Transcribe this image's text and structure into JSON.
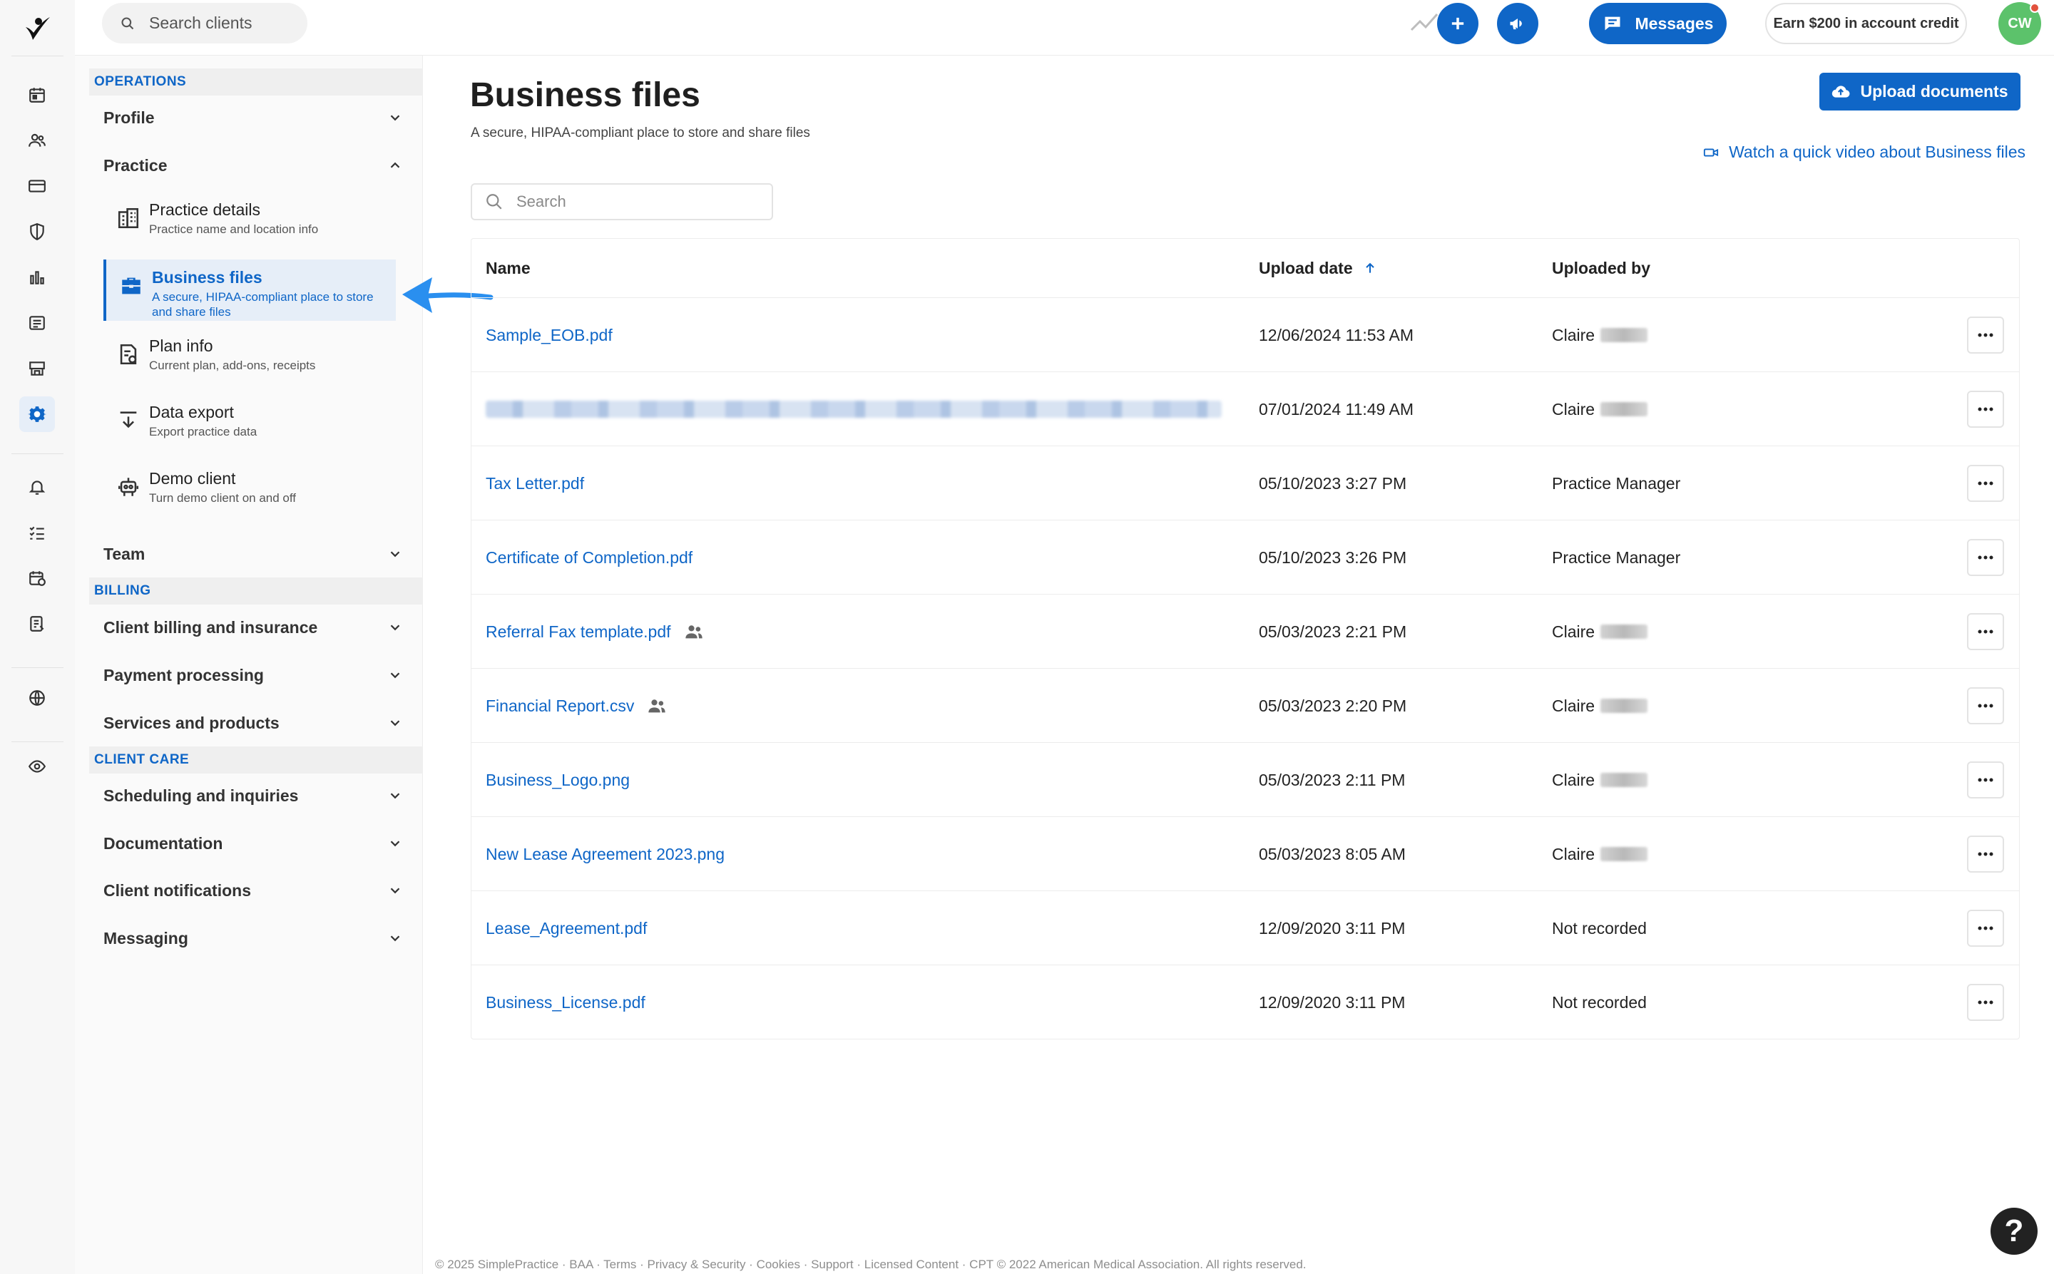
{
  "topbar": {
    "search_placeholder": "Search clients",
    "messages_label": "Messages",
    "earn_label": "Earn $200 in account credit",
    "avatar_initials": "CW"
  },
  "sidebar": {
    "sections": {
      "operations": "OPERATIONS",
      "billing": "BILLING",
      "client_care": "CLIENT CARE"
    },
    "accordions": {
      "profile": "Profile",
      "practice": "Practice",
      "team": "Team",
      "client_billing": "Client billing and insurance",
      "payment_processing": "Payment processing",
      "services_products": "Services and products",
      "scheduling": "Scheduling and inquiries",
      "documentation": "Documentation",
      "client_notifications": "Client notifications",
      "messaging": "Messaging"
    },
    "practice_items": [
      {
        "title": "Practice details",
        "desc": "Practice name and location info"
      },
      {
        "title": "Business files",
        "desc": "A secure, HIPAA-compliant place to store and share files"
      },
      {
        "title": "Plan info",
        "desc": "Current plan, add-ons, receipts"
      },
      {
        "title": "Data export",
        "desc": "Export practice data"
      },
      {
        "title": "Demo client",
        "desc": "Turn demo client on and off"
      }
    ]
  },
  "main": {
    "title": "Business files",
    "subtitle": "A secure, HIPAA-compliant place to store and share files",
    "upload_label": "Upload documents",
    "video_link": "Watch a quick video about Business files",
    "search_placeholder": "Search",
    "columns": {
      "name": "Name",
      "upload_date": "Upload date",
      "uploaded_by": "Uploaded by"
    },
    "files": [
      {
        "name": "Sample_EOB.pdf",
        "date": "12/06/2024 11:53 AM",
        "by": "Claire"
      },
      {
        "name": "",
        "date": "07/01/2024 11:49 AM",
        "by": "Claire"
      },
      {
        "name": "Tax Letter.pdf",
        "date": "05/10/2023 3:27 PM",
        "by": "Practice Manager"
      },
      {
        "name": "Certificate of Completion.pdf",
        "date": "05/10/2023 3:26 PM",
        "by": "Practice Manager"
      },
      {
        "name": "Referral Fax template.pdf",
        "date": "05/03/2023 2:21 PM",
        "by": "Claire"
      },
      {
        "name": "Financial Report.csv",
        "date": "05/03/2023 2:20 PM",
        "by": "Claire"
      },
      {
        "name": "Business_Logo.png",
        "date": "05/03/2023 2:11 PM",
        "by": "Claire"
      },
      {
        "name": "New Lease Agreement 2023.png",
        "date": "05/03/2023 8:05 AM",
        "by": "Claire"
      },
      {
        "name": "Lease_Agreement.pdf",
        "date": "12/09/2020 3:11 PM",
        "by": "Not recorded"
      },
      {
        "name": "Business_License.pdf",
        "date": "12/09/2020 3:11 PM",
        "by": "Not recorded"
      }
    ]
  },
  "footer": "© 2025 SimplePractice · BAA · Terms · Privacy & Security · Cookies · Support · Licensed Content · CPT © 2022 American Medical Association. All rights reserved.",
  "help_label": "?",
  "colors": {
    "accent": "#0f66c7",
    "active_bg": "#e6eef8",
    "avatar": "#5cc26b"
  }
}
